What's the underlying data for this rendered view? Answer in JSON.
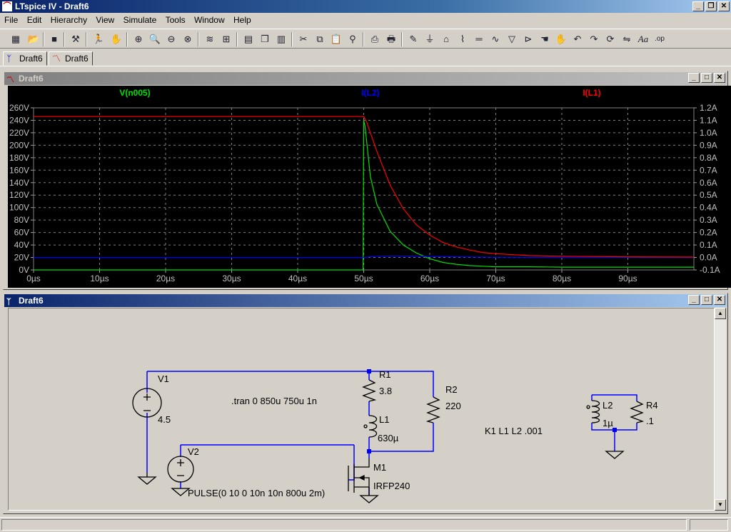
{
  "window": {
    "title": "LTspice IV - Draft6",
    "app_icon": "ltspice-app-icon"
  },
  "window_buttons": [
    "_",
    "❐",
    "✕"
  ],
  "menu": [
    "File",
    "Edit",
    "Hierarchy",
    "View",
    "Simulate",
    "Tools",
    "Window",
    "Help"
  ],
  "toolbar": {
    "icons": [
      "open-schematic-icon",
      "open-file-icon",
      "save-icon",
      "control-panel-icon",
      "run-icon",
      "halt-icon",
      "zoom-in-icon",
      "zoom-area-icon",
      "zoom-out-icon",
      "zoom-fit-icon",
      "autorange-icon",
      "grid-icon",
      "tile-horizontal-icon",
      "cascade-icon",
      "tile-vertical-icon",
      "cut-icon",
      "copy-icon",
      "paste-icon",
      "find-icon",
      "print-preview-icon",
      "print-icon",
      "draw-wire-icon",
      "ground-icon",
      "label-net-icon",
      "resistor-icon",
      "capacitor-icon",
      "inductor-icon",
      "diode-icon",
      "component-icon",
      "move-icon",
      "drag-icon",
      "undo-icon",
      "redo-icon",
      "rotate-icon",
      "mirror-icon",
      "text-icon",
      "spice-directive-icon"
    ],
    "text_icon_label": "Aa",
    "directive_icon_label": ".op"
  },
  "tabs": [
    {
      "label": "Draft6",
      "icon": "schematic-icon"
    },
    {
      "label": "Draft6",
      "icon": "waveform-icon"
    }
  ],
  "plot_window": {
    "title": "Draft6",
    "traces": [
      {
        "name": "V(n005)",
        "color": "#00e000"
      },
      {
        "name": "I(L2)",
        "color": "#0000ff"
      },
      {
        "name": "I(L1)",
        "color": "#ff0000"
      }
    ]
  },
  "chart_data": {
    "type": "line",
    "x_ticks": [
      "0µs",
      "10µs",
      "20µs",
      "30µs",
      "40µs",
      "50µs",
      "60µs",
      "70µs",
      "80µs",
      "90µs"
    ],
    "xlim": [
      0,
      100
    ],
    "y_left_ticks": [
      "260V",
      "240V",
      "220V",
      "200V",
      "180V",
      "160V",
      "140V",
      "120V",
      "100V",
      "80V",
      "60V",
      "40V",
      "20V",
      "0V"
    ],
    "ylim_left": [
      0,
      260
    ],
    "y_right_ticks": [
      "1.2A",
      "1.1A",
      "1.0A",
      "0.9A",
      "0.8A",
      "0.7A",
      "0.6A",
      "0.5A",
      "0.4A",
      "0.3A",
      "0.2A",
      "0.1A",
      "0.0A",
      "-0.1A"
    ],
    "ylim_right": [
      -0.1,
      1.2
    ],
    "grid": true,
    "legend": "top",
    "background": "#000000",
    "series": [
      {
        "name": "V(n005)",
        "axis": "left",
        "color": "#00e000",
        "x": [
          0,
          49.9,
          50,
          50.2,
          51,
          52,
          54,
          56,
          58,
          60,
          62,
          64,
          66,
          68,
          70,
          75,
          80,
          90,
          100
        ],
        "y": [
          0,
          0,
          240,
          230,
          150,
          105,
          62,
          40,
          27,
          18,
          12,
          9,
          7,
          6,
          5,
          5,
          4.5,
          4.5,
          4.5
        ]
      },
      {
        "name": "I(L2)",
        "axis": "right",
        "color": "#0000ff",
        "x": [
          0,
          49.9,
          50,
          52,
          55,
          58,
          62,
          66,
          70,
          80,
          100
        ],
        "y": [
          0,
          0,
          0,
          0.01,
          0.013,
          0.01,
          0.006,
          0.004,
          0.002,
          0.001,
          0
        ]
      },
      {
        "name": "I(L1)",
        "axis": "right",
        "color": "#ff0000",
        "x": [
          0,
          49.9,
          50,
          50.5,
          51,
          52,
          54,
          56,
          58,
          60,
          62,
          64,
          66,
          68,
          70,
          75,
          80,
          90,
          100
        ],
        "y": [
          1.13,
          1.13,
          1.13,
          1.08,
          1.0,
          0.85,
          0.58,
          0.39,
          0.26,
          0.18,
          0.12,
          0.085,
          0.06,
          0.04,
          0.03,
          0.015,
          0.01,
          0.005,
          0.003
        ]
      }
    ]
  },
  "schematic_window": {
    "title": "Draft6",
    "components": {
      "v1": {
        "name": "V1",
        "value": "4.5"
      },
      "v2": {
        "name": "V2",
        "value": "PULSE(0 10 0 10n 10n 800u 2m)"
      },
      "r1": {
        "name": "R1",
        "value": "3.8"
      },
      "r2": {
        "name": "R2",
        "value": "220"
      },
      "l1": {
        "name": "L1",
        "value": "630µ"
      },
      "m1": {
        "name": "M1",
        "value": "IRFP240"
      },
      "l2": {
        "name": "L2",
        "value": "1µ"
      },
      "r4": {
        "name": "R4",
        "value": ".1"
      }
    },
    "directives": {
      "tran": ".tran 0 850u 750u 1n",
      "coupling": "K1 L1 L2 .001"
    },
    "wire_color": "#0000ff"
  }
}
